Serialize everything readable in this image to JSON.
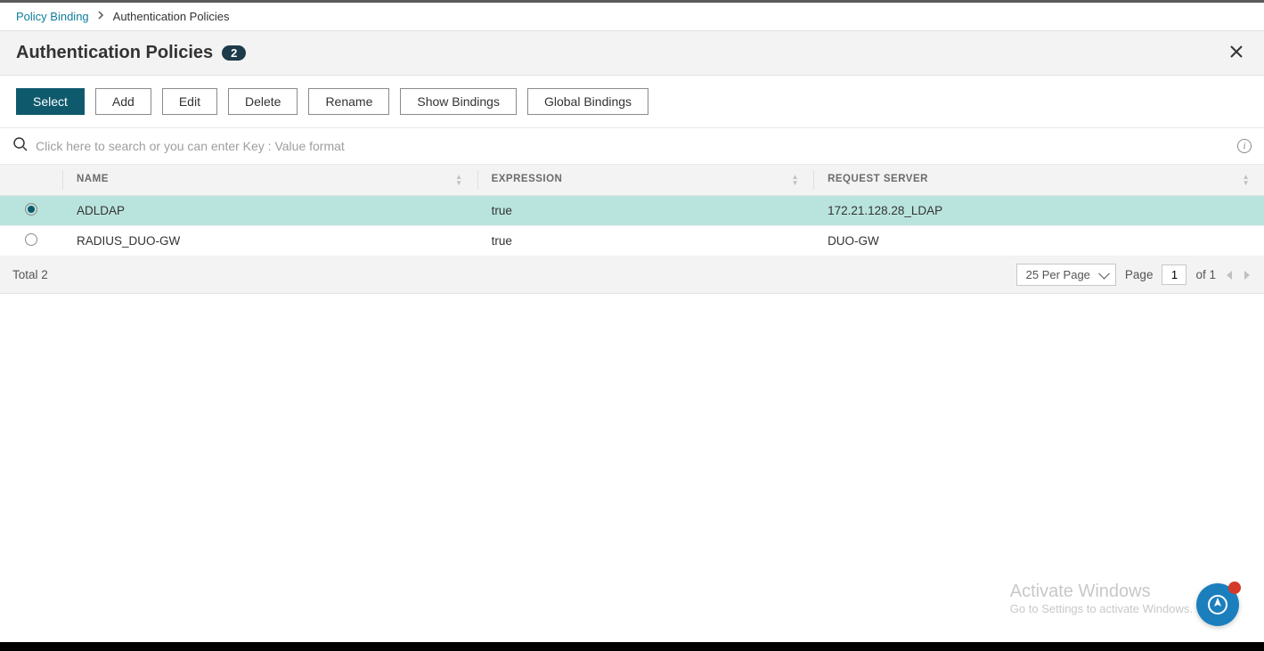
{
  "breadcrumb": {
    "root": "Policy Binding",
    "current": "Authentication Policies"
  },
  "title": "Authentication Policies",
  "count": "2",
  "toolbar": {
    "select": "Select",
    "add": "Add",
    "edit": "Edit",
    "delete": "Delete",
    "rename": "Rename",
    "show_bindings": "Show Bindings",
    "global_bindings": "Global Bindings"
  },
  "search": {
    "placeholder": "Click here to search or you can enter Key : Value format",
    "value": ""
  },
  "columns": {
    "name": "NAME",
    "expression": "EXPRESSION",
    "request_server": "REQUEST SERVER"
  },
  "rows": [
    {
      "selected": true,
      "name": "ADLDAP",
      "expression": "true",
      "request_server": "172.21.128.28_LDAP"
    },
    {
      "selected": false,
      "name": "RADIUS_DUO-GW",
      "expression": "true",
      "request_server": "DUO-GW"
    }
  ],
  "footer": {
    "total_label": "Total",
    "total": "2",
    "per_page": "25 Per Page",
    "page_label": "Page",
    "page": "1",
    "of_label": "of",
    "page_total": "1"
  },
  "watermark": {
    "line1": "Activate Windows",
    "line2": "Go to Settings to activate Windows."
  }
}
